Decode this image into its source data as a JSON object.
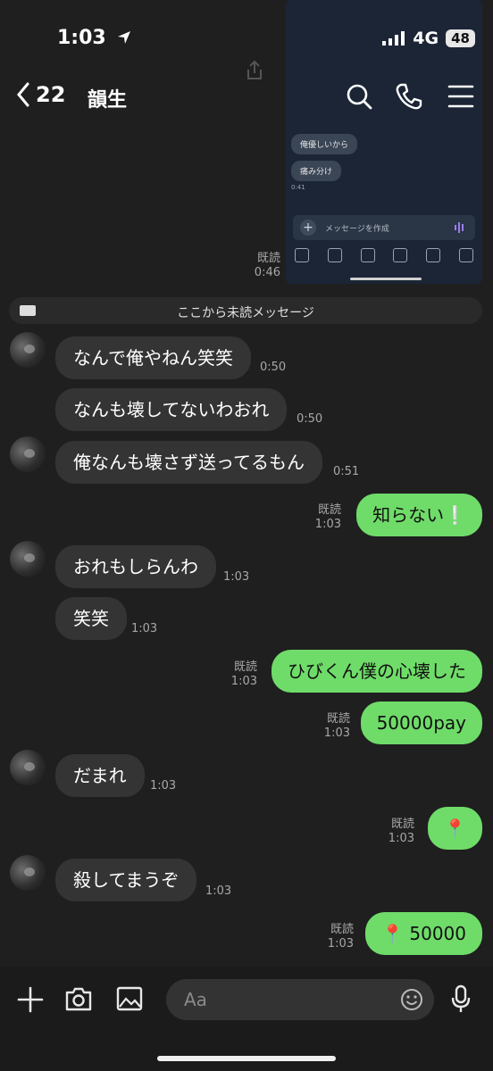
{
  "status": {
    "time": "1:03",
    "network": "4G",
    "battery": "48"
  },
  "header": {
    "back_count": "22",
    "title": "韻生"
  },
  "embedded": {
    "bubbles": [
      "俺優しいから",
      "痛み分け"
    ],
    "time": "0:41",
    "composer_placeholder": "メッセージを作成"
  },
  "first": {
    "read": "既読",
    "time": "0:46"
  },
  "unread_label": "ここから未読メッセージ",
  "messages": [
    {
      "text": "なんで俺やねん笑笑",
      "time": "0:50"
    },
    {
      "text": "なんも壊してないわおれ",
      "time": "0:50"
    },
    {
      "text": "俺なんも壊さず送ってるもん",
      "time": "0:51"
    },
    {
      "text": "知らない❕",
      "read": "既読",
      "time": "1:03"
    },
    {
      "text": "おれもしらんわ",
      "time": "1:03"
    },
    {
      "text": "笑笑",
      "time": "1:03"
    },
    {
      "text": "ひびくん僕の心壊した",
      "read": "既読",
      "time": "1:03"
    },
    {
      "text": "50000pay",
      "read": "既読",
      "time": "1:03"
    },
    {
      "text": "だまれ",
      "time": "1:03"
    },
    {
      "text": "📍",
      "read": "既読",
      "time": "1:03"
    },
    {
      "text": "殺してまうぞ",
      "time": "1:03"
    },
    {
      "text": "📍 50000",
      "read": "既読",
      "time": "1:03"
    }
  ],
  "input": {
    "placeholder": "Aa"
  },
  "colors": {
    "outgoing": "#6fdc69",
    "incoming": "#343434",
    "background": "#1f1f1f"
  }
}
